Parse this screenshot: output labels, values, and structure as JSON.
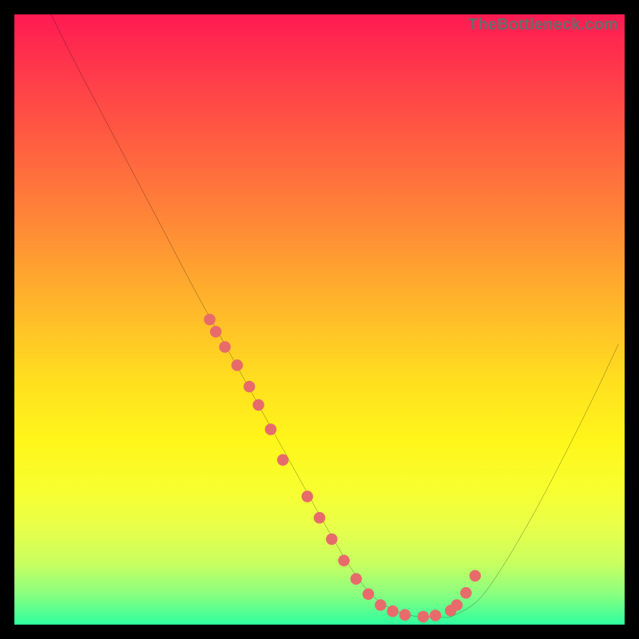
{
  "watermark": "TheBottleneck.com",
  "chart_data": {
    "type": "line",
    "title": "",
    "xlabel": "",
    "ylabel": "",
    "xlim": [
      0,
      100
    ],
    "ylim": [
      0,
      100
    ],
    "series": [
      {
        "name": "curve",
        "x": [
          6,
          10,
          15,
          20,
          25,
          30,
          35,
          40,
          45,
          50,
          52,
          55,
          58,
          61,
          65,
          70,
          72,
          76,
          80,
          85,
          90,
          95,
          99
        ],
        "y": [
          100,
          92,
          82.5,
          73,
          63.5,
          54,
          45,
          36,
          27,
          18,
          14.5,
          9.5,
          5.5,
          3,
          1.5,
          1.2,
          1.5,
          4,
          9.5,
          18,
          27.5,
          37.5,
          46
        ]
      }
    ],
    "highlight_band": {
      "y_from": 0,
      "y_to": 22
    },
    "highlight_points": {
      "name": "dots",
      "x": [
        32,
        33,
        34.5,
        36.5,
        38.5,
        40,
        42,
        44,
        48,
        50,
        52,
        54,
        56,
        58,
        60,
        62,
        64,
        67,
        69,
        71.5,
        72.5,
        74,
        75.5
      ],
      "y": [
        50,
        48,
        45.5,
        42.5,
        39,
        36,
        32,
        27,
        21,
        17.5,
        14,
        10.5,
        7.5,
        5,
        3.2,
        2.2,
        1.6,
        1.3,
        1.5,
        2.3,
        3.2,
        5.2,
        8
      ]
    },
    "colors": {
      "curve": "#000000",
      "dots": "#e86b6b",
      "gradient_top": "#ff1a52",
      "gradient_bottom": "#2eff9e"
    }
  }
}
